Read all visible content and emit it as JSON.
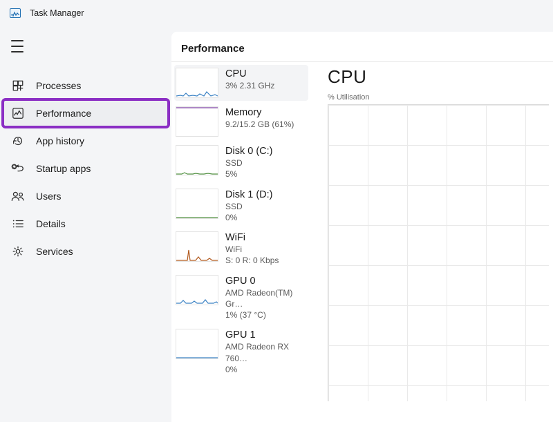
{
  "app": {
    "title": "Task Manager"
  },
  "sidebar": {
    "items": [
      {
        "label": "Processes",
        "icon": "processes-icon"
      },
      {
        "label": "Performance",
        "icon": "performance-icon",
        "highlighted": true
      },
      {
        "label": "App history",
        "icon": "history-icon"
      },
      {
        "label": "Startup apps",
        "icon": "startup-icon"
      },
      {
        "label": "Users",
        "icon": "users-icon"
      },
      {
        "label": "Details",
        "icon": "details-icon"
      },
      {
        "label": "Services",
        "icon": "services-icon"
      }
    ]
  },
  "main": {
    "header": "Performance",
    "chart": {
      "title": "CPU",
      "subtitle": "% Utilisation"
    },
    "perf_items": [
      {
        "title": "CPU",
        "sub1": "3%  2.31 GHz",
        "sub2": "",
        "color": "#3b82c4",
        "selected": true,
        "spark_type": "cpu"
      },
      {
        "title": "Memory",
        "sub1": "9.2/15.2 GB (61%)",
        "sub2": "",
        "color": "#7b3fa0",
        "spark_type": "mem"
      },
      {
        "title": "Disk 0 (C:)",
        "sub1": "SSD",
        "sub2": "5%",
        "color": "#4f8f3f",
        "spark_type": "disk-low"
      },
      {
        "title": "Disk 1 (D:)",
        "sub1": "SSD",
        "sub2": "0%",
        "color": "#4f8f3f",
        "spark_type": "flat"
      },
      {
        "title": "WiFi",
        "sub1": "WiFi",
        "sub2": "S: 0 R: 0 Kbps",
        "color": "#b25a1f",
        "spark_type": "wifi"
      },
      {
        "title": "GPU 0",
        "sub1": "AMD Radeon(TM) Gr…",
        "sub2": "1%  (37 °C)",
        "color": "#3b82c4",
        "spark_type": "gpu-low"
      },
      {
        "title": "GPU 1",
        "sub1": "AMD Radeon RX 760…",
        "sub2": "0%",
        "color": "#3b82c4",
        "spark_type": "flat"
      }
    ]
  },
  "colors": {
    "highlight": "#8b2ec4"
  }
}
